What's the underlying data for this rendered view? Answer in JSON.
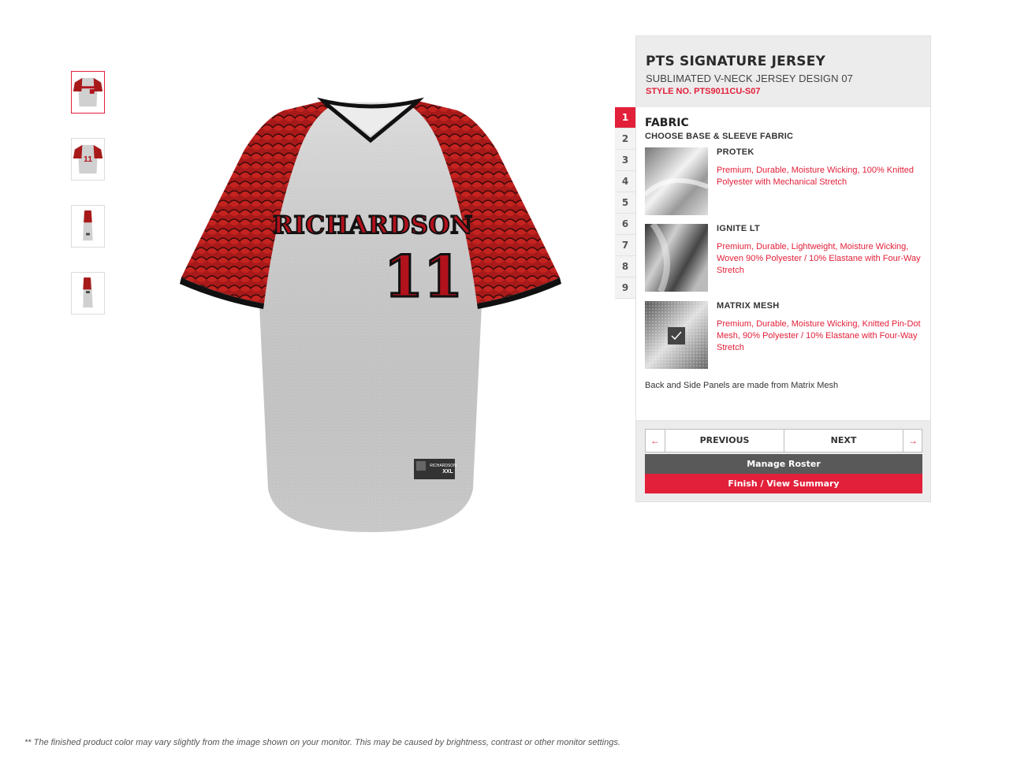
{
  "thumbnails": [
    {
      "label": "front-view",
      "active": true
    },
    {
      "label": "back-view",
      "active": false
    },
    {
      "label": "left-side-view",
      "active": false
    },
    {
      "label": "right-side-view",
      "active": false
    }
  ],
  "jersey": {
    "team_name": "RICHARDSON",
    "number": "11",
    "tag_brand": "RICHARDSON",
    "tag_size": "XXL",
    "colors": {
      "body": "#d2d2d2",
      "sleeve": "#a81a1a",
      "sleeve_dark": "#3a0a0a",
      "trim": "#111111",
      "lettering": "#b1121c"
    }
  },
  "product": {
    "title": "PTS SIGNATURE JERSEY",
    "subtitle": "SUBLIMATED V-NECK JERSEY DESIGN 07",
    "style_no": "STYLE NO. PTS9011CU-S07"
  },
  "steps": [
    "1",
    "2",
    "3",
    "4",
    "5",
    "6",
    "7",
    "8",
    "9"
  ],
  "active_step": "1",
  "fabric_section": {
    "title": "FABRIC",
    "subtitle": "CHOOSE BASE & SLEEVE FABRIC",
    "options": [
      {
        "name": "PROTEK",
        "description": "Premium, Durable, Moisture Wicking, 100% Knitted Polyester with Mechanical Stretch",
        "selected": false
      },
      {
        "name": "IGNITE LT",
        "description": "Premium, Durable, Lightweight, Moisture Wicking, Woven 90% Polyester / 10% Elastane with Four-Way Stretch",
        "selected": false
      },
      {
        "name": "MATRIX MESH",
        "description": "Premium, Durable, Moisture Wicking, Knitted Pin-Dot Mesh, 90% Polyester / 10% Elastane with Four-Way Stretch",
        "selected": true
      }
    ],
    "note": "Back and Side Panels are made from Matrix Mesh"
  },
  "nav": {
    "previous_label": "PREVIOUS",
    "next_label": "NEXT",
    "prev_icon": "arrow-left-icon",
    "next_icon": "arrow-right-icon"
  },
  "actions": {
    "roster_label": "Manage Roster",
    "finish_label": "Finish / View  Summary"
  },
  "disclaimer": "** The finished product color may vary slightly from the image shown on your monitor. This may be caused by brightness, contrast or other monitor settings.",
  "accent_color": "#e2203a"
}
